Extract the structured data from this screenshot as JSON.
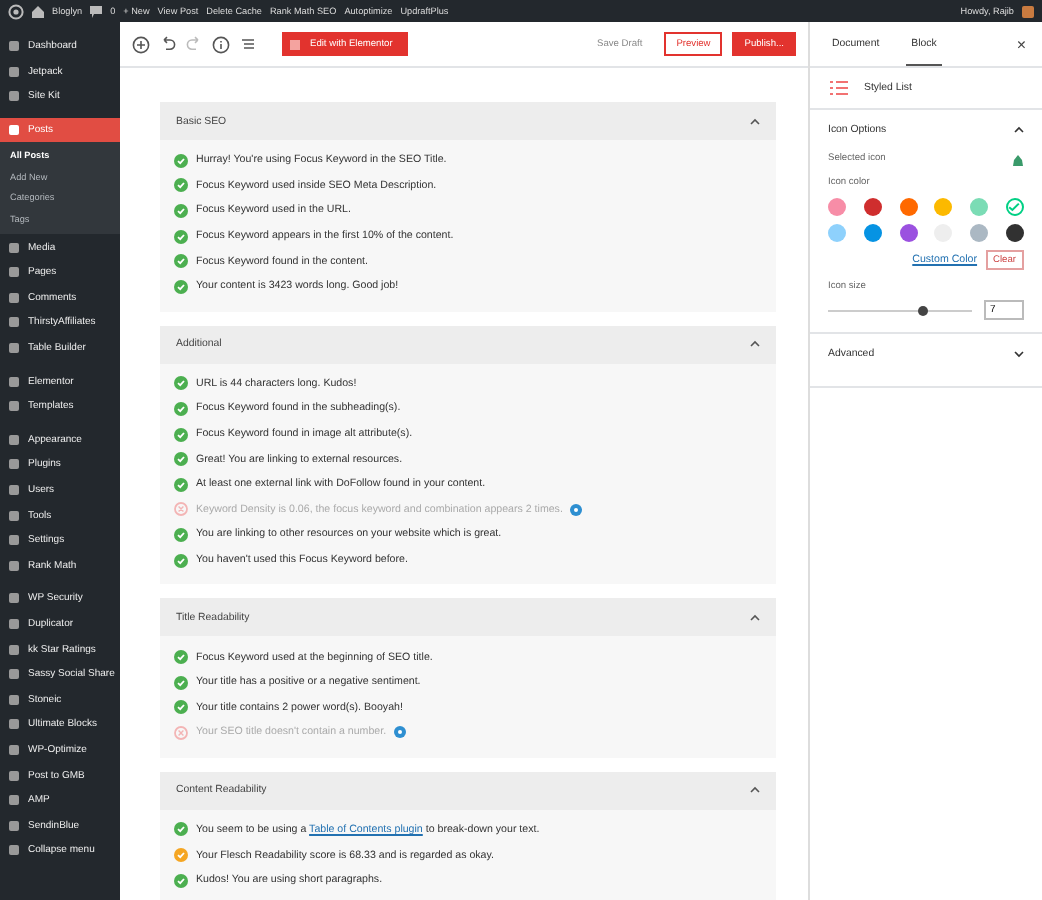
{
  "admin_bar": {
    "site": "Bloglyn",
    "comments": "0",
    "items": [
      "+ New",
      "View Post",
      "Delete Cache",
      "Rank Math SEO",
      "Autoptimize",
      "UpdraftPlus"
    ],
    "greeting": "Howdy, Rajib"
  },
  "sidebar": {
    "groups": [
      [
        {
          "label": "Dashboard",
          "selected": false
        },
        {
          "label": "Jetpack",
          "selected": false
        },
        {
          "label": "Site Kit",
          "selected": false
        }
      ],
      [
        {
          "label": "Posts",
          "selected": true,
          "children": [
            {
              "label": "All Posts",
              "selected": true
            },
            {
              "label": "Add New",
              "selected": false
            },
            {
              "label": "Categories",
              "selected": false
            },
            {
              "label": "Tags",
              "selected": false
            }
          ]
        },
        {
          "label": "Media",
          "selected": false
        },
        {
          "label": "Pages",
          "selected": false
        },
        {
          "label": "Comments",
          "selected": false
        },
        {
          "label": "ThirstyAffiliates",
          "selected": false
        },
        {
          "label": "Table Builder",
          "selected": false
        }
      ],
      [
        {
          "label": "Elementor",
          "selected": false
        },
        {
          "label": "Templates",
          "selected": false
        }
      ],
      [
        {
          "label": "Appearance",
          "selected": false
        },
        {
          "label": "Plugins",
          "selected": false
        },
        {
          "label": "Users",
          "selected": false
        },
        {
          "label": "Tools",
          "selected": false
        },
        {
          "label": "Settings",
          "selected": false
        },
        {
          "label": "Rank Math",
          "selected": false
        }
      ],
      [
        {
          "label": "WP Security",
          "selected": false
        },
        {
          "label": "Duplicator",
          "selected": false
        },
        {
          "label": "kk Star Ratings",
          "selected": false
        },
        {
          "label": "Sassy Social Share",
          "selected": false
        },
        {
          "label": "Stoneic",
          "selected": false
        },
        {
          "label": "Ultimate Blocks",
          "selected": false
        },
        {
          "label": "WP-Optimize",
          "selected": false
        },
        {
          "label": "Post to GMB",
          "selected": false
        },
        {
          "label": "AMP",
          "selected": false
        },
        {
          "label": "SendinBlue",
          "selected": false
        },
        {
          "label": "Collapse menu",
          "selected": false
        }
      ]
    ]
  },
  "toolbar": {
    "elementor_button": "Edit with Elementor",
    "save_draft": "Save Draft",
    "preview": "Preview",
    "publish": "Publish..."
  },
  "sections": [
    {
      "title": "Basic SEO",
      "expanded": true,
      "checks": [
        {
          "kind": "pass",
          "text": "Hurray! You're using Focus Keyword in the SEO Title.",
          "help": false
        },
        {
          "kind": "pass",
          "text": "Focus Keyword used inside SEO Meta Description.",
          "help": false
        },
        {
          "kind": "pass",
          "text": "Focus Keyword used in the URL.",
          "help": false
        },
        {
          "kind": "pass",
          "text": "Focus Keyword appears in the first 10% of the content.",
          "help": false
        },
        {
          "kind": "pass",
          "text": "Focus Keyword found in the content.",
          "help": false
        },
        {
          "kind": "pass",
          "text": "Your content is 3423 words long. Good job!",
          "help": false
        }
      ]
    },
    {
      "title": "Additional",
      "expanded": true,
      "checks": [
        {
          "kind": "pass",
          "text": "URL is 44 characters long. Kudos!",
          "help": false
        },
        {
          "kind": "pass",
          "text": "Focus Keyword found in the subheading(s).",
          "help": false
        },
        {
          "kind": "pass",
          "text": "Focus Keyword found in image alt attribute(s).",
          "help": false
        },
        {
          "kind": "pass",
          "text": "Great! You are linking to external resources.",
          "help": false
        },
        {
          "kind": "pass",
          "text": "At least one external link with DoFollow found in your content.",
          "help": false
        },
        {
          "kind": "fail",
          "text": "Keyword Density is 0.06, the focus keyword and combination appears 2 times.",
          "help": true
        },
        {
          "kind": "pass",
          "text": "You are linking to other resources on your website which is great.",
          "help": false
        },
        {
          "kind": "pass",
          "text": "You haven't used this Focus Keyword before.",
          "help": false
        }
      ]
    },
    {
      "title": "Title Readability",
      "expanded": true,
      "checks": [
        {
          "kind": "pass",
          "text": "Focus Keyword used at the beginning of SEO title.",
          "help": false
        },
        {
          "kind": "pass",
          "text": "Your title has a positive or a negative sentiment.",
          "help": false
        },
        {
          "kind": "pass",
          "text": "Your title contains 2 power word(s). Booyah!",
          "help": false
        },
        {
          "kind": "fail",
          "text": "Your SEO title doesn't contain a number.",
          "help": true
        }
      ]
    },
    {
      "title": "Content Readability",
      "expanded": true,
      "checks": [
        {
          "kind": "pass",
          "text": "You seem to be using a ",
          "link": "Table of Contents plugin",
          "text_after": " to break-down your text.",
          "help": false
        },
        {
          "kind": "warn",
          "text": "Your Flesch Readability score is 68.33 and is regarded as okay.",
          "help": false
        },
        {
          "kind": "pass",
          "text": "Kudos! You are using short paragraphs.",
          "help": false
        }
      ]
    }
  ],
  "panel": {
    "tabs": [
      {
        "label": "Document",
        "selected": false
      },
      {
        "label": "Block",
        "selected": true
      }
    ],
    "close": "×",
    "block_name": "Styled List",
    "icon_options": {
      "title": "Icon Options",
      "expanded": true,
      "selected_icon_label": "Selected icon",
      "icon_color_label": "Icon color",
      "colors": [
        {
          "color": "#f78da7",
          "selected": false
        },
        {
          "color": "#cf2e2e",
          "selected": false
        },
        {
          "color": "#ff6900",
          "selected": false
        },
        {
          "color": "#fcb900",
          "selected": false
        },
        {
          "color": "#7bdcb5",
          "selected": false
        },
        {
          "color": "#00d084",
          "selected": true
        },
        {
          "color": "#8ed1fc",
          "selected": false
        },
        {
          "color": "#0693e3",
          "selected": false
        },
        {
          "color": "#9b51e0",
          "selected": false
        },
        {
          "color": "#eeeeee",
          "selected": false
        },
        {
          "color": "#abb8c3",
          "selected": false
        },
        {
          "color": "#313131",
          "selected": false
        }
      ],
      "custom_color": "Custom Color",
      "clear": "Clear",
      "icon_size_label": "Icon size",
      "icon_size": {
        "level": 0.66,
        "value": "7"
      }
    },
    "advanced": {
      "title": "Advanced",
      "expanded": false
    }
  }
}
